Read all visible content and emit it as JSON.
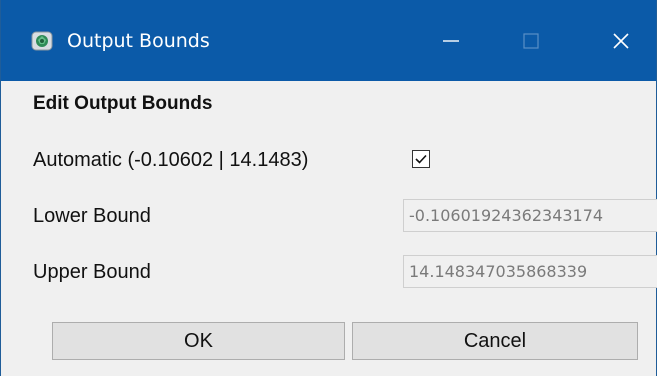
{
  "window": {
    "title": "Output Bounds",
    "icon": "app-icon",
    "controls": {
      "minimize_icon": "minimize-icon",
      "maximize_icon": "maximize-icon",
      "close_icon": "close-icon"
    },
    "titlebar_color": "#0b5aa8"
  },
  "dialog": {
    "heading": "Edit Output Bounds",
    "automatic_label": "Automatic (-0.10602 | 14.1483)",
    "automatic_checked": true,
    "lower_bound_label": "Lower Bound",
    "lower_bound_value": "-0.10601924362343174",
    "upper_bound_label": "Upper Bound",
    "upper_bound_value": "14.148347035868339",
    "ok_label": "OK",
    "cancel_label": "Cancel"
  }
}
